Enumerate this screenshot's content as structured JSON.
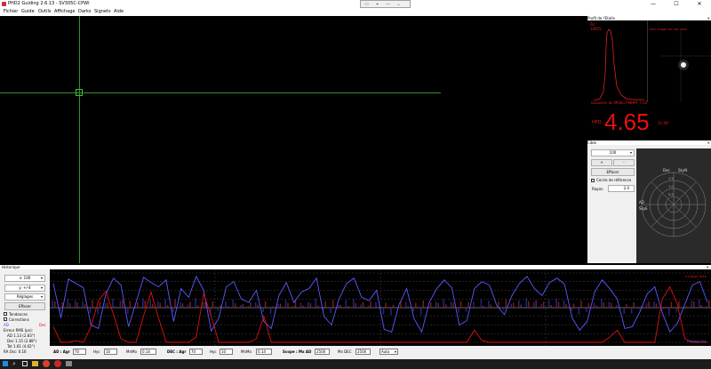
{
  "window": {
    "title": "PHD2 Guiding 2.6.13 - SV305C-CPWI",
    "minimize": "—",
    "maximize": "☐",
    "close": "✕"
  },
  "float_toolbar": {
    "icons": [
      "monitor-icon",
      "target-icon",
      "line-icon",
      "chevron-down-icon"
    ]
  },
  "menu": [
    "Fichier",
    "Guide",
    "Outils",
    "Affichage",
    "Darks",
    "Signets",
    "Aide"
  ],
  "star_profile": {
    "header": "Profil de l'Etoile",
    "peak_label": "Pic",
    "peak_value": "10855",
    "click_hint": "Click image for raw view",
    "fwhm_label": "Gaussien du Milieu FWHM: 7.02",
    "hfd_label": "HFD:",
    "hfd_value": "4.65",
    "hfd_unit": "11.60\""
  },
  "polar_panel": {
    "header": "Cible",
    "zoom_select": "100",
    "plus": "+",
    "minus": "-",
    "clear_button": "Effacer",
    "ref_circle_label": "Cercle de référence",
    "radius_label": "Rayon",
    "radius_value": "2.0",
    "axis_labels": {
      "dec": "Dec",
      "ra": "AD",
      "skyn": "SkyN",
      "skye": "SkyE"
    },
    "ring_labels": [
      "1.5",
      "1.0",
      "0.5"
    ]
  },
  "history": {
    "header": "Historique",
    "x_select": "x: 100",
    "y_select": "y: +/-4",
    "settings_select": "Réglages",
    "clear_button": "Effacer",
    "trends_label": "Tendances",
    "corrections_label": "Corrections",
    "ad_label": "AD",
    "dec_label": "Dec",
    "rms_title": "Erreur RMS (px):",
    "rms_ad": "AD 1.13 (2.83\")",
    "rms_dec": "Dec 1.15 (2.88\")",
    "rms_tot": "Tot 1.61 (4.02\")",
    "ra_osc": "RA Osc: 0.16",
    "guiding_rate_top": "Guidage Rate",
    "guiding_rate_bottom": "Guidage Est"
  },
  "toolbar": {
    "ad_agr_label": "AD : Agr",
    "ad_agr": "70",
    "ad_hyst_label": "Hyc",
    "ad_hyst": "10",
    "ad_minmo_label": "MnMo",
    "ad_minmo": "0.14",
    "dec_agr_label": "DEC : Agr",
    "dec_agr": "70",
    "dec_hyst_label": "Hyc",
    "dec_hyst": "10",
    "dec_minmo_label": "MnMo",
    "dec_minmo": "0.14",
    "scope_label": "Scope : Mx AD",
    "mx_ad": "2500",
    "mx_dec_label": "Mx DEC",
    "mx_dec": "2500",
    "auto_select": "Auto"
  },
  "colors": {
    "ra": "#5a5aff",
    "dec": "#e01010",
    "crosshair": "#2f8f2f",
    "hfd": "#e81010"
  },
  "graph_data": {
    "ra": [
      2.8,
      -1.2,
      3.3,
      2.8,
      2.3,
      -2.0,
      -2.4,
      1.6,
      3.4,
      2.6,
      -2.2,
      0.6,
      3.5,
      2.9,
      2.4,
      3.2,
      -1.6,
      2.2,
      1.2,
      3.6,
      2.0,
      -2.7,
      -1.2,
      2.4,
      3.0,
      1.0,
      0.6,
      2.0,
      -1.6,
      -2.4,
      1.4,
      2.9,
      0.6,
      1.8,
      2.2,
      3.4,
      -1.0,
      -2.0,
      1.0,
      2.8,
      3.4,
      1.2,
      0.8,
      2.0,
      -2.5,
      -2.8,
      0.4,
      2.2,
      -1.3,
      -2.8,
      0.6,
      2.2,
      3.2,
      2.3,
      -2.0,
      -1.5,
      2.2,
      3.0,
      2.6,
      0.2,
      -0.8,
      1.4,
      2.8,
      3.6,
      2.2,
      1.4,
      2.9,
      3.4,
      2.7,
      -1.2,
      -2.6,
      -1.6,
      1.8,
      3.2,
      2.2,
      1.0,
      -2.4,
      -2.2,
      -0.5,
      1.6,
      2.4,
      -0.6,
      -2.8,
      -1.8,
      0.4,
      2.6,
      3.0,
      0.6
    ],
    "dec": [
      -2.2,
      -4.0,
      -4.0,
      -3.8,
      -4.0,
      -2.2,
      0.8,
      1.9,
      -0.8,
      -3.6,
      -4.0,
      -4.0,
      -1.0,
      1.8,
      -1.2,
      -4.0,
      -4.0,
      -4.0,
      -4.0,
      -3.4,
      1.6,
      -1.0,
      -4.0,
      -4.0,
      -4.0,
      -4.0,
      -4.0,
      -3.6,
      -1.0,
      -4.0,
      -4.0,
      -4.0,
      -4.0,
      -4.0,
      -4.0,
      -4.0,
      -4.0,
      -4.0,
      -4.0,
      -4.0,
      -4.0,
      -4.0,
      -4.0,
      -4.0,
      -4.0,
      -4.0,
      -4.0,
      -4.0,
      -4.0,
      -4.0,
      -4.0,
      -4.0,
      -4.0,
      -4.0,
      -4.0,
      -4.0,
      -2.6,
      -3.8,
      -4.0,
      -4.0,
      -4.0,
      -4.0,
      -4.0,
      -4.0,
      -4.0,
      -4.0,
      -4.0,
      -4.0,
      -4.0,
      -4.0,
      -4.0,
      -4.0,
      -4.0,
      -4.0,
      -3.4,
      -2.6,
      -4.0,
      -4.0,
      -4.0,
      -4.0,
      -4.0,
      1.0,
      2.4,
      0.4,
      -3.6,
      -4.0,
      -4.0,
      -4.0
    ],
    "ylim": [
      -4,
      4
    ]
  },
  "taskbar": {
    "icons": [
      "windows-icon",
      "search-icon",
      "task-view-icon",
      "explorer-icon",
      "chrome-icon",
      "phd2-icon",
      "app-icon"
    ]
  }
}
